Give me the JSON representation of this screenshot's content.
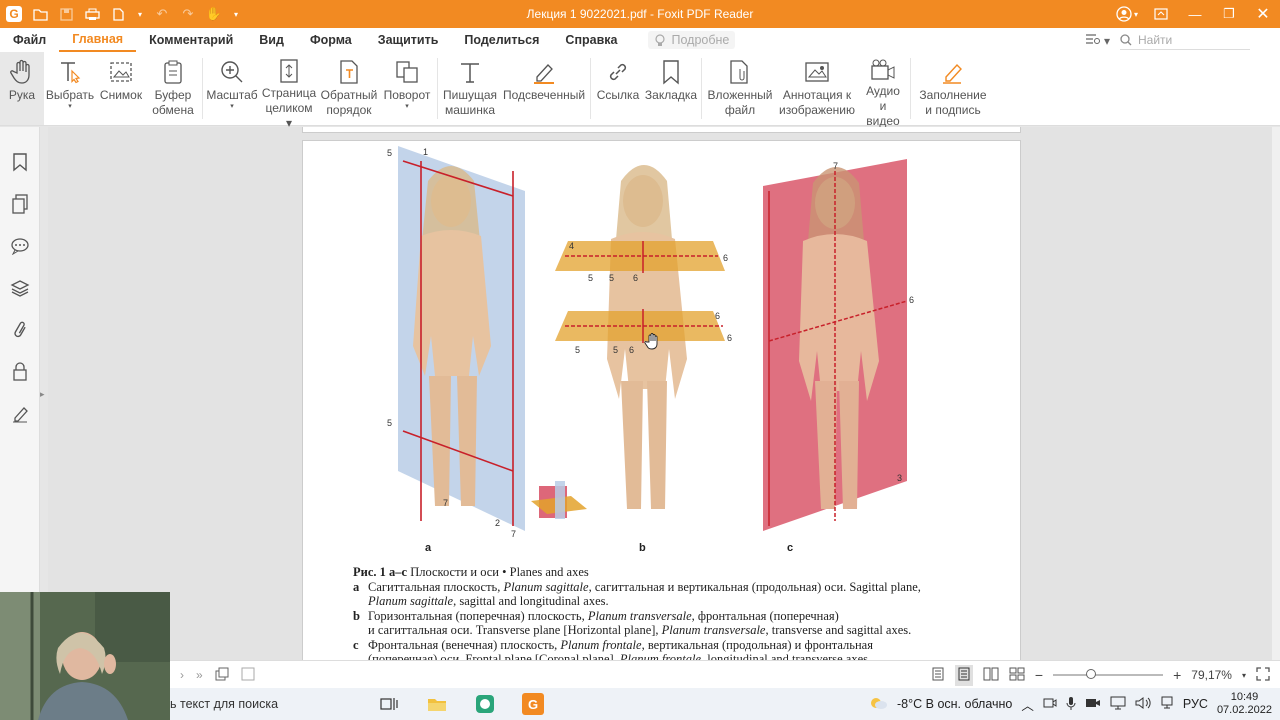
{
  "window": {
    "title": "Лекция 1 9022021.pdf - Foxit PDF Reader",
    "logo_letter": "G"
  },
  "menu": {
    "items": [
      "Файл",
      "Главная",
      "Комментарий",
      "Вид",
      "Форма",
      "Защитить",
      "Поделиться",
      "Справка"
    ],
    "active": "Главная",
    "hint": "Подробне",
    "search_placeholder": "Найти"
  },
  "ribbon": {
    "tools": [
      {
        "label1": "Рука",
        "label2": "",
        "icon": "hand-icon"
      },
      {
        "label1": "Выбрать",
        "label2": "",
        "icon": "select-text-icon"
      },
      {
        "label1": "Снимок",
        "label2": "",
        "icon": "snapshot-icon"
      },
      {
        "label1": "Буфер",
        "label2": "обмена",
        "icon": "clipboard-icon"
      },
      {
        "label1": "Масштаб",
        "label2": "",
        "icon": "zoom-icon"
      },
      {
        "label1": "Страница",
        "label2": "целиком",
        "icon": "fit-page-icon"
      },
      {
        "label1": "Обратный",
        "label2": "порядок",
        "icon": "reverse-order-icon"
      },
      {
        "label1": "Поворот",
        "label2": "",
        "icon": "rotate-icon"
      },
      {
        "label1": "Пишущая",
        "label2": "машинка",
        "icon": "typewriter-icon"
      },
      {
        "label1": "Подсвеченный",
        "label2": "",
        "icon": "highlight-icon"
      },
      {
        "label1": "Ссылка",
        "label2": "",
        "icon": "link-icon"
      },
      {
        "label1": "Закладка",
        "label2": "",
        "icon": "bookmark-icon"
      },
      {
        "label1": "Вложенный",
        "label2": "файл",
        "icon": "attach-file-icon"
      },
      {
        "label1": "Аннотация к",
        "label2": "изображению",
        "icon": "image-annotation-icon"
      },
      {
        "label1": "Аудио",
        "label2": "и видео",
        "icon": "media-icon"
      },
      {
        "label1": "Заполнение",
        "label2": "и подпись",
        "icon": "fill-sign-icon"
      }
    ]
  },
  "figure": {
    "panel_a": "a",
    "panel_b": "b",
    "panel_c": "c",
    "numbers_a": [
      "5",
      "1",
      "5",
      "7",
      "2",
      "7"
    ],
    "numbers_b": [
      "4",
      "5",
      "5",
      "6",
      "6",
      "5",
      "5",
      "6",
      "6",
      "6"
    ],
    "numbers_c": [
      "7",
      "6",
      "3"
    ]
  },
  "caption": {
    "title_bold": "Рис. 1 а–с",
    "title_rest": " Плоскости и оси • Planes and axes",
    "a_key": "a",
    "a_text1": "Сагиттальная плоскость, ",
    "a_italic1": "Planum sagittale",
    "a_text2": ", сагиттальная и вертикальная (продольная) оси. Sagittal plane,",
    "a_italic2": "Planum sagittale",
    "a_text3": ", sagittal and longitudinal axes.",
    "b_key": "b",
    "b_text1": "Горизонтальная (поперечная) плоскость, ",
    "b_italic1": "Planum transversale",
    "b_text2": ", фронтальная (поперечная)",
    "b_text3": "и сагиттальная оси. Transverse plane [Horizontal plane], ",
    "b_italic2": "Planum transversale",
    "b_text4": ", transverse and sagittal axes.",
    "c_key": "c",
    "c_text1": "Фронтальная (венечная) плоскость, ",
    "c_italic1": "Planum frontale",
    "c_text2": ", вертикальная (продольная) и фронтальная",
    "c_text3": "(поперечная) оси. Frontal plane [Coronal plane], ",
    "c_italic2": "Planum frontale",
    "c_text4": ", longitudinal and transverse axes."
  },
  "status": {
    "zoom": "79,17%",
    "zoom_fraction": 0.3
  },
  "taskbar": {
    "search": "ь текст для поиска",
    "weather": "-8°C  В осн. облачно",
    "lang": "РУС",
    "time": "10:49",
    "date": "07.02.2022"
  },
  "colors": {
    "accent": "#f28a22",
    "sagittal_plane": "#b9cde6",
    "transverse_plane": "#e3a22c",
    "frontal_plane": "#d9576a"
  }
}
